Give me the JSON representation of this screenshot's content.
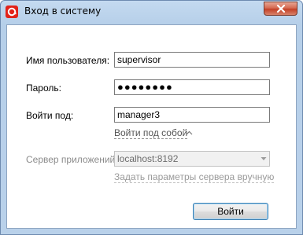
{
  "window": {
    "title": "Вход в систему",
    "app_icon": "lsfusion-logo-icon",
    "close_icon": "close-icon"
  },
  "form": {
    "username_label": "Имя пользователя:",
    "username_value": "supervisor",
    "password_label": "Пароль:",
    "password_value": "●●●●●●●●",
    "login_as_label": "Войти под:",
    "login_as_value": "manager3",
    "login_self_link": "Войти под собой",
    "server_label": "Сервер приложений:",
    "server_value": "localhost:8192",
    "server_params_link": "Задать параметры сервера вручную",
    "login_button": "Войти"
  },
  "colors": {
    "accent": "#e2231a",
    "title_bar": "#b9d1ea",
    "close_button": "#c34127"
  }
}
